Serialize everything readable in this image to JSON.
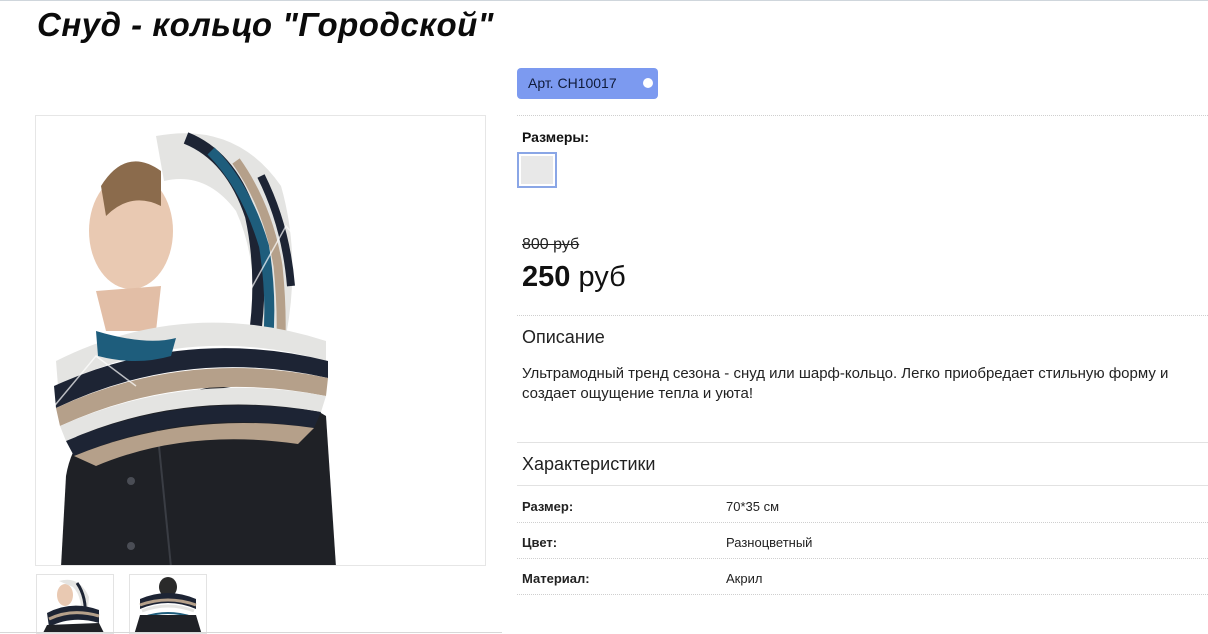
{
  "product": {
    "title": "Снуд - кольцо \"Городской\"",
    "sku": "Арт. СН10017"
  },
  "sizes": {
    "label": "Размеры:",
    "options": [
      ""
    ]
  },
  "price": {
    "old": "800 руб",
    "new_amount": "250",
    "new_currency": "руб"
  },
  "description": {
    "heading": "Описание",
    "text": "Ультрамодный тренд сезона - снуд или шарф-кольцо. Легко приобредает стильную форму и создает ощущение тепла и уюта!"
  },
  "characteristics": {
    "heading": "Характеристики",
    "rows": [
      {
        "key": "Размер:",
        "value": "70*35 см"
      },
      {
        "key": "Цвет:",
        "value": "Разноцветный"
      },
      {
        "key": "Материал:",
        "value": "Акрил"
      }
    ]
  },
  "gallery": {
    "thumbnails": [
      "thumb-front",
      "thumb-back"
    ]
  },
  "colors": {
    "sku_badge": "#7c9af0",
    "swatch_border": "#8aa6e6",
    "scarf_navy": "#1d2434",
    "scarf_teal": "#1e5d7c",
    "scarf_beige": "#b5a08a",
    "scarf_white": "#e4e4e2"
  }
}
